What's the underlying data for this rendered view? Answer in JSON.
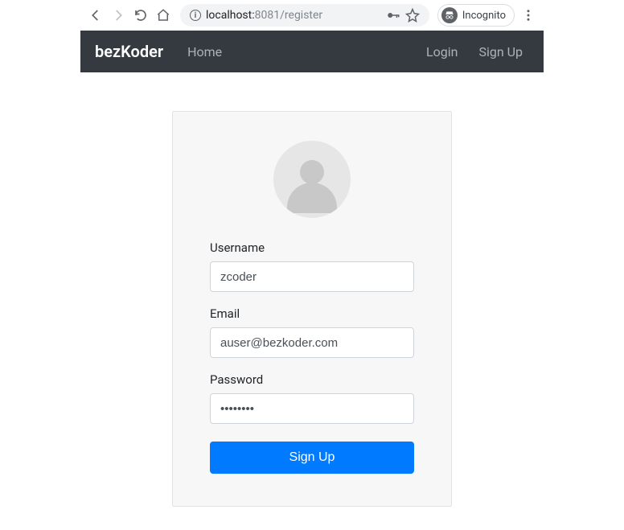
{
  "browser": {
    "url_host": "localhost:",
    "url_port": "8081",
    "url_path": "/register",
    "incognito_label": "Incognito"
  },
  "navbar": {
    "brand": "bezKoder",
    "links": {
      "home": "Home",
      "login": "Login",
      "signup": "Sign Up"
    }
  },
  "form": {
    "username_label": "Username",
    "username_value": "zcoder",
    "email_label": "Email",
    "email_value": "auser@bezkoder.com",
    "password_label": "Password",
    "password_value": "••••••••",
    "submit_label": "Sign Up"
  }
}
